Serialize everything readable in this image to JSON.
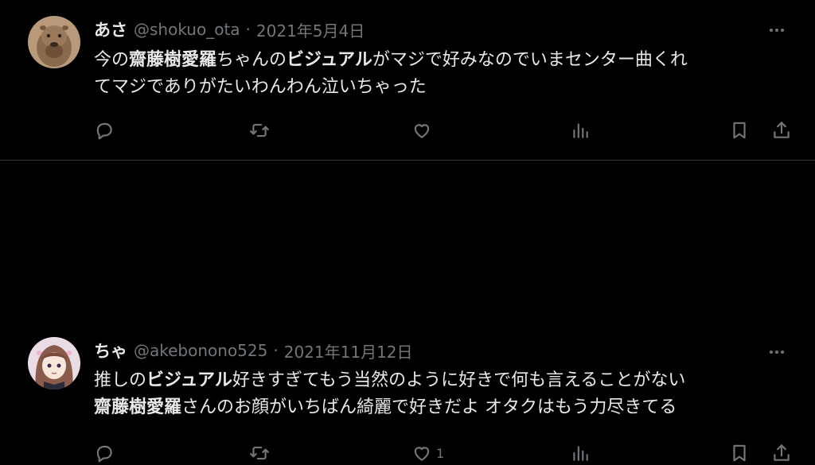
{
  "tweets": [
    {
      "display_name": "あさ",
      "handle": "@shokuo_ota",
      "separator": "·",
      "date": "2021年5月4日",
      "avatar_icon": "avatar-capybara",
      "body_parts": [
        {
          "text": "今の",
          "bold": false
        },
        {
          "text": "齋藤樹愛羅",
          "bold": true
        },
        {
          "text": "ちゃんの",
          "bold": false
        },
        {
          "text": "ビジュアル",
          "bold": true
        },
        {
          "text": "がマジで好みなのでいまセンター曲くれ\nてマジでありがたいわんわん泣いちゃった",
          "bold": false
        }
      ],
      "like_count": ""
    },
    {
      "display_name": "ちゃ",
      "handle": "@akebonono525",
      "separator": "·",
      "date": "2021年11月12日",
      "avatar_icon": "avatar-anime-girl",
      "body_parts": [
        {
          "text": "推しの",
          "bold": false
        },
        {
          "text": "ビジュアル",
          "bold": true
        },
        {
          "text": "好きすぎてもう当然のように好きで何も言えることがない\n",
          "bold": false
        },
        {
          "text": "齋藤樹愛羅",
          "bold": true
        },
        {
          "text": "さんのお顔がいちばん綺麗で好きだよ オタクはもう力尽きてる",
          "bold": false
        }
      ],
      "like_count": "1"
    }
  ],
  "colors": {
    "background": "#000000",
    "text_primary": "#e7e9ea",
    "text_secondary": "#71767b",
    "divider": "#2f3336"
  },
  "action_icons": [
    "reply-icon",
    "retweet-icon",
    "like-icon",
    "views-icon",
    "bookmark-icon",
    "share-icon"
  ]
}
